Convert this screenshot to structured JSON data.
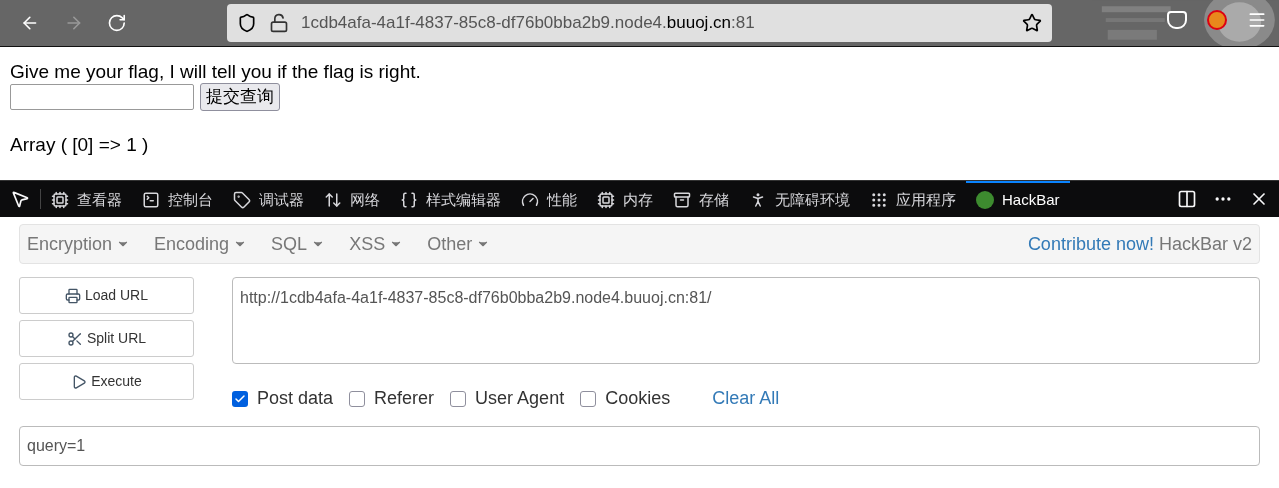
{
  "browser": {
    "url_prefix": "1cdb4afa-4a1f-4837-85c8-df76b0bba2b9.node4.",
    "url_domain": "buuoj.cn",
    "url_suffix": ":81"
  },
  "page": {
    "prompt": "Give me your flag, I will tell you if the flag is right.",
    "submit": "提交查询",
    "output": "Array ( [0] => 1 )"
  },
  "devtools_tabs": [
    {
      "label": "查看器",
      "selected": false
    },
    {
      "label": "控制台",
      "selected": false
    },
    {
      "label": "调试器",
      "selected": false
    },
    {
      "label": "网络",
      "selected": false
    },
    {
      "label": "样式编辑器",
      "selected": false
    },
    {
      "label": "性能",
      "selected": false
    },
    {
      "label": "内存",
      "selected": false
    },
    {
      "label": "存储",
      "selected": false
    },
    {
      "label": "无障碍环境",
      "selected": false
    },
    {
      "label": "应用程序",
      "selected": false
    },
    {
      "label": "HackBar",
      "selected": true
    }
  ],
  "hackbar": {
    "menus": [
      "Encryption",
      "Encoding",
      "SQL",
      "XSS",
      "Other"
    ],
    "contribute_link": "Contribute now!",
    "version": "HackBar v2",
    "buttons": [
      "Load URL",
      "Split URL",
      "Execute"
    ],
    "url": "http://1cdb4afa-4a1f-4837-85c8-df76b0bba2b9.node4.buuoj.cn:81/",
    "options": [
      {
        "label": "Post data",
        "checked": true
      },
      {
        "label": "Referer",
        "checked": false
      },
      {
        "label": "User Agent",
        "checked": false
      },
      {
        "label": "Cookies",
        "checked": false
      }
    ],
    "clear_all": "Clear All",
    "post_data": "query=1"
  }
}
